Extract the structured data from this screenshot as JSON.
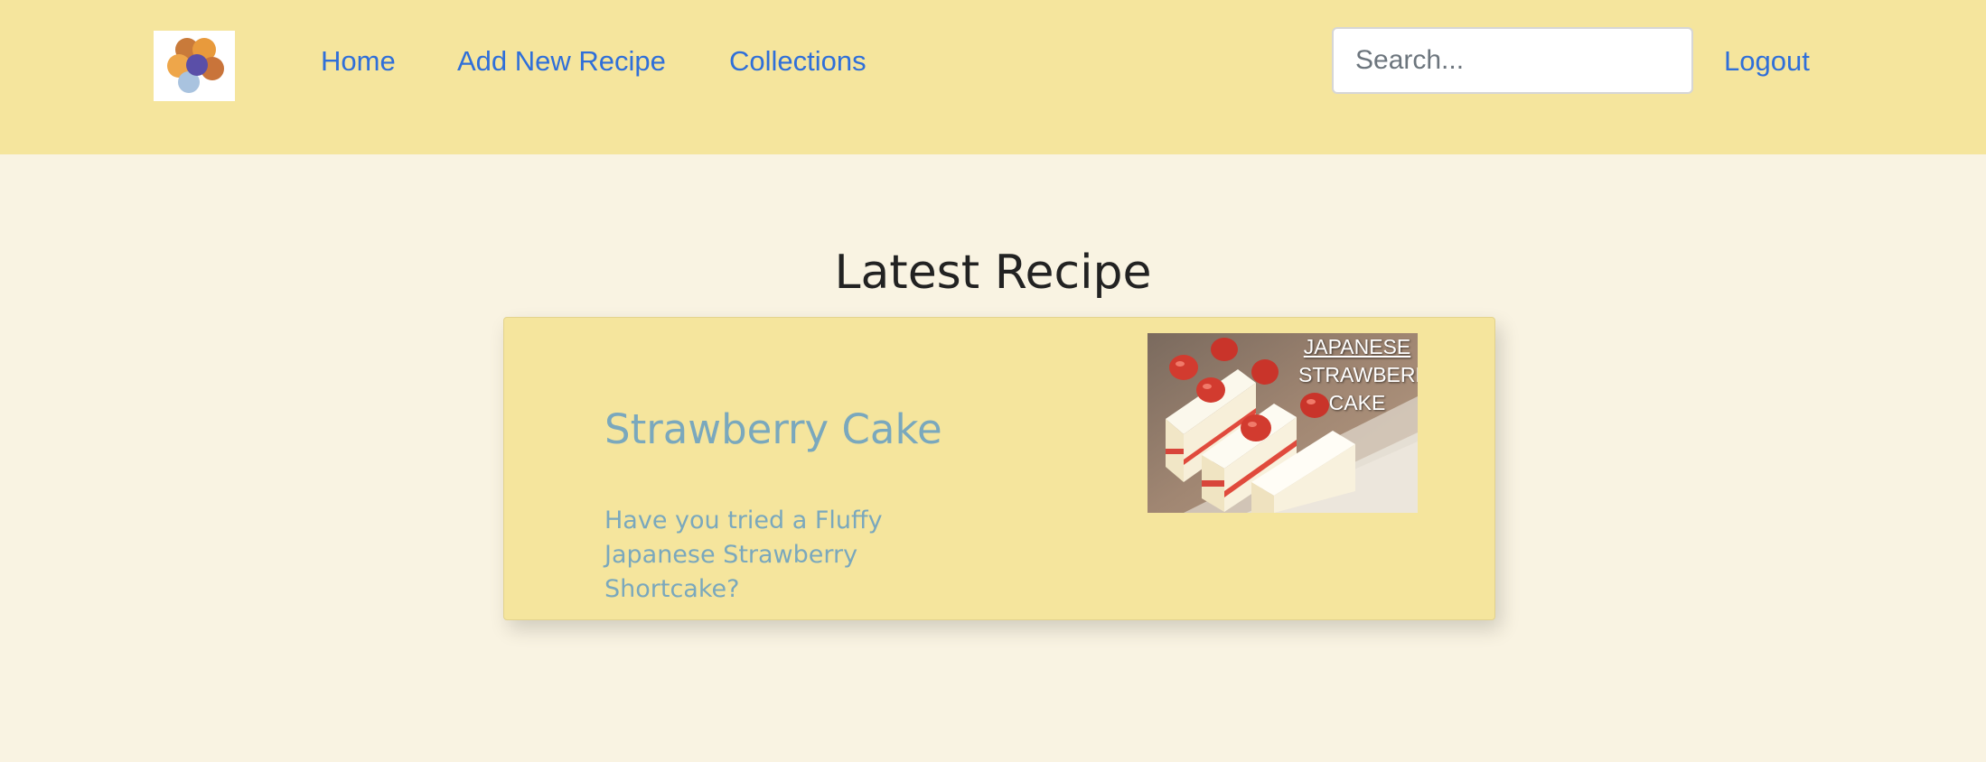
{
  "navbar": {
    "logo_name": "flower-logo",
    "links": {
      "home": "Home",
      "add_recipe": "Add New Recipe",
      "collections": "Collections",
      "logout": "Logout"
    },
    "search": {
      "placeholder": "Search...",
      "value": ""
    }
  },
  "main": {
    "heading": "Latest Recipe",
    "recipe": {
      "title": "Strawberry Cake",
      "description": "Have you tried a Fluffy Japanese Strawberry Shortcake?",
      "image_caption": [
        "JAPANESE",
        "STRAWBERRY",
        "CAKE"
      ]
    }
  },
  "colors": {
    "navbar_bg": "#f5e59d",
    "page_bg": "#f9f3e2",
    "link": "#2f6fd9",
    "card_bg": "#f5e59d",
    "card_text": "#7aa8bd",
    "heading": "#222222"
  }
}
